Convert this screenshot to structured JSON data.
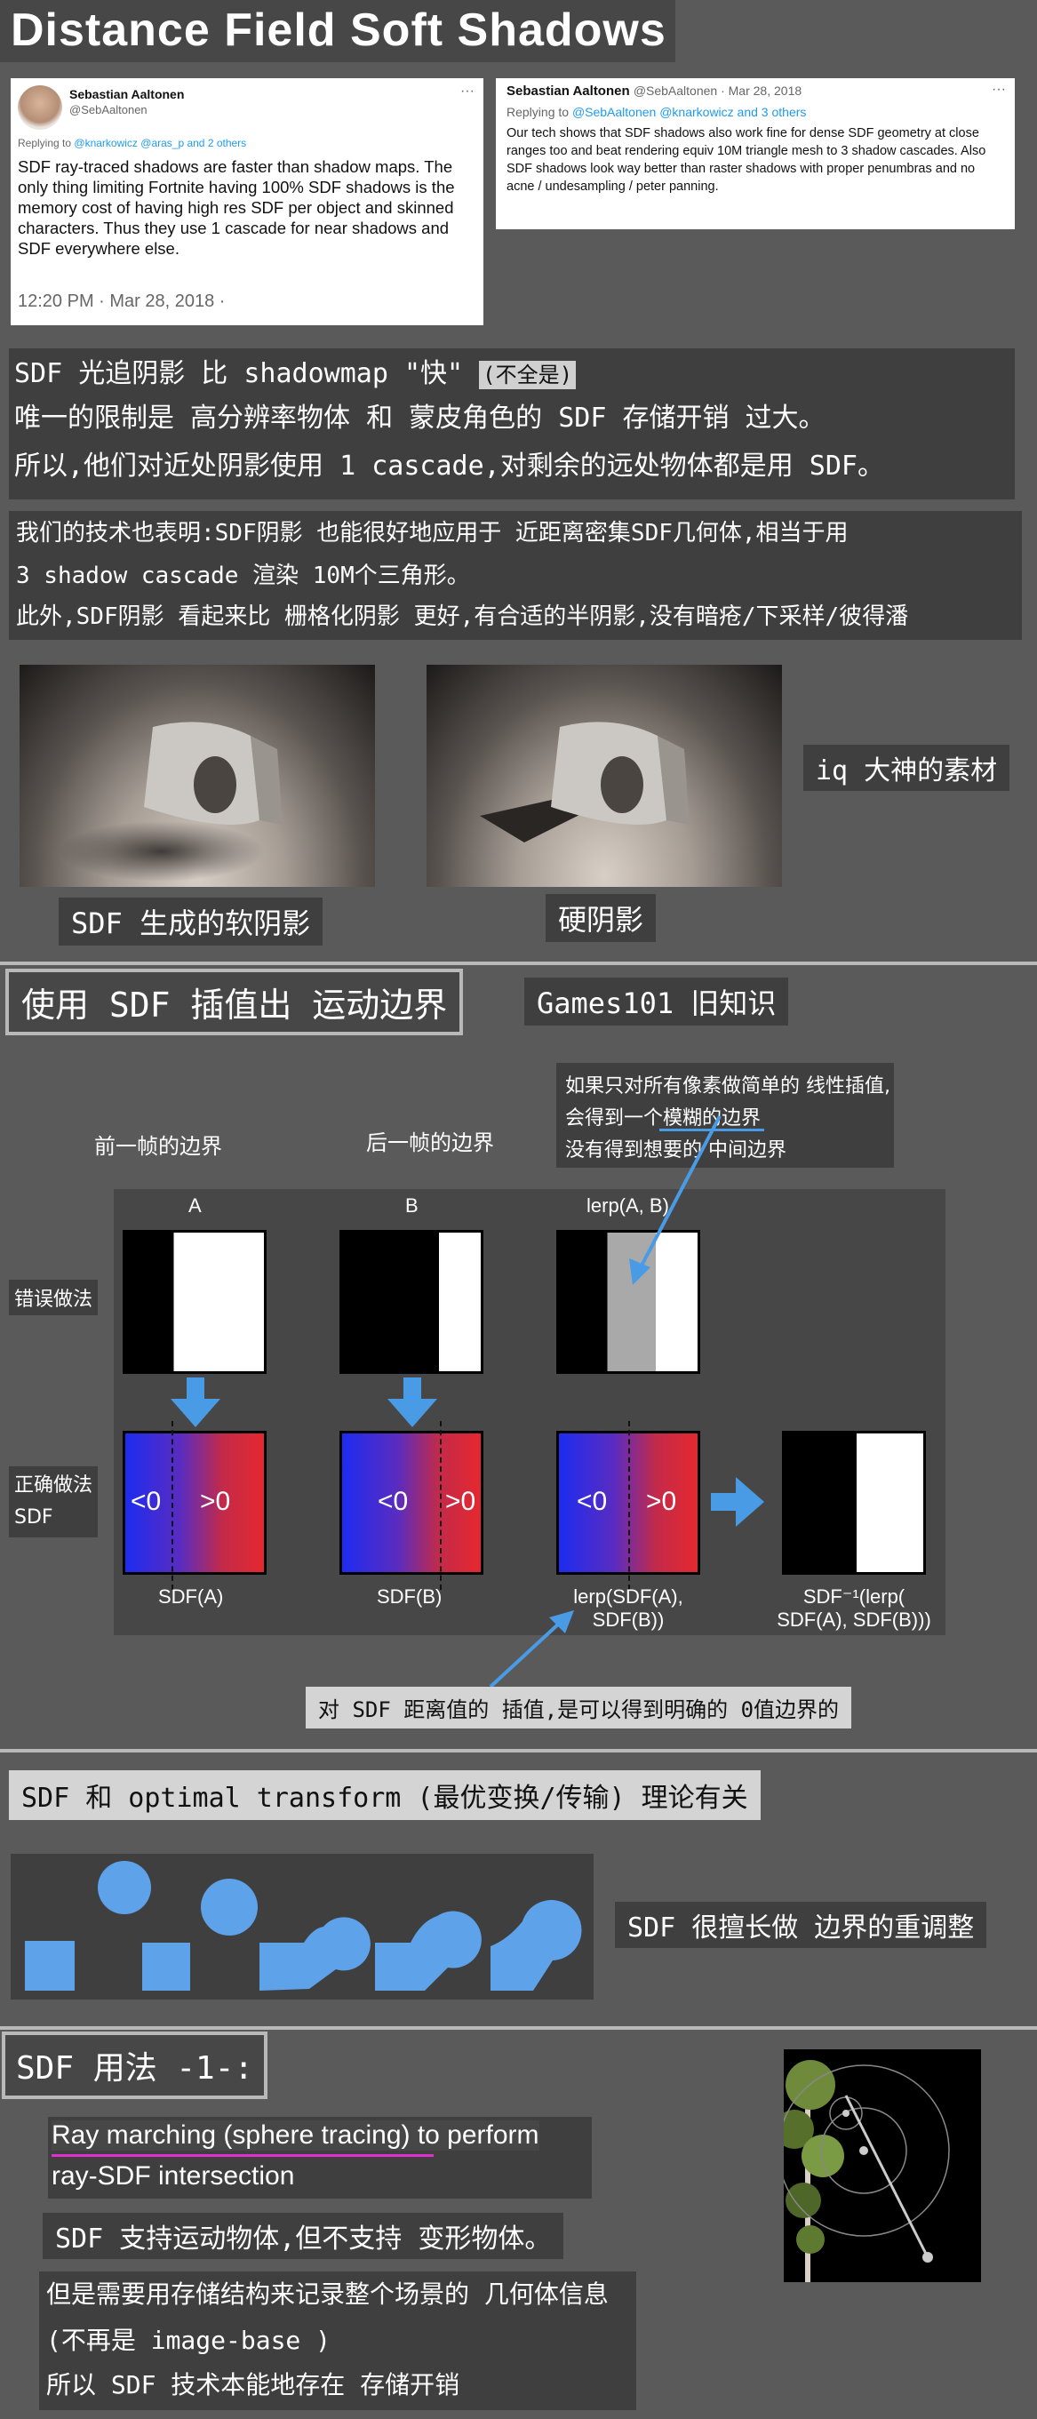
{
  "title": "Distance Field Soft Shadows",
  "tweet1": {
    "name": "Sebastian Aaltonen",
    "handle": "@SebAaltonen",
    "more": "···",
    "reply_prefix": "Replying to",
    "reply_to": "@knarkowicz @aras_p and 2 others",
    "body": "SDF ray-traced shadows are faster than shadow maps. The only thing limiting Fortnite having 100% SDF shadows is the memory cost of having high res SDF per object and skinned characters. Thus they use 1 cascade for near shadows and SDF everywhere else.",
    "time": "12:20 PM · Mar 28, 2018 ·"
  },
  "tweet2": {
    "name": "Sebastian Aaltonen",
    "handle": "@SebAaltonen · Mar 28, 2018",
    "more": "···",
    "reply_prefix": "Replying to",
    "reply_to": "@SebAaltonen @knarkowicz and 3 others",
    "body": "Our tech shows that SDF shadows also work fine for dense SDF geometry at close ranges too and beat rendering equiv 10M triangle mesh to 3 shadow cascades. Also SDF shadows look way better than raster shadows with proper penumbras and no acne / undesampling / peter panning."
  },
  "notes1": {
    "line1": "SDF 光追阴影 比 shadowmap \"快\"",
    "line1_tag": "(不全是)",
    "line2": "唯一的限制是 高分辨率物体 和 蒙皮角色的 SDF 存储开销 过大。",
    "line3": "所以,他们对近处阴影使用 1 cascade,对剩余的远处物体都是用 SDF。"
  },
  "notes2": {
    "line1": "我们的技术也表明:SDF阴影 也能很好地应用于 近距离密集SDF几何体,相当于用",
    "line2": "3 shadow cascade 渲染 10M个三角形。",
    "line3": "此外,SDF阴影 看起来比 栅格化阴影 更好,有合适的半阴影,没有暗疮/下采样/彼得潘"
  },
  "shadow_section": {
    "soft_label": "SDF 生成的软阴影",
    "hard_label": "硬阴影",
    "source_label": "iq 大神的素材"
  },
  "interp_section": {
    "heading": "使用 SDF 插值出 运动边界",
    "tag": "Games101 旧知识",
    "prev_frame": "前一帧的边界",
    "next_frame": "后一帧的边界",
    "note1": "如果只对所有像素做简单的 线性插值,",
    "note2": "会得到一个模糊的边界",
    "note3": "没有得到想要的 中间边界",
    "col_a": "A",
    "col_b": "B",
    "col_lerp": "lerp(A, B)",
    "wrong": "错误做法",
    "right1": "正确做法",
    "right2": "SDF",
    "neg": "<0",
    "pos": ">0",
    "sdf_a": "SDF(A)",
    "sdf_b": "SDF(B)",
    "lerp_sdf1": "lerp(SDF(A),",
    "lerp_sdf2": "SDF(B))",
    "inv1": "SDF⁻¹(lerp(",
    "inv2": "SDF(A), SDF(B)))",
    "bottom_note": "对 SDF 距离值的 插值,是可以得到明确的 0值边界的"
  },
  "ot_section": {
    "heading": "SDF 和 optimal transform (最优变换/传输) 理论有关",
    "side_note": "SDF 很擅长做 边界的重调整",
    "shape_color": "#5ea2ea"
  },
  "usage_section": {
    "heading": "SDF 用法 -1-:",
    "rm1": "Ray marching (sphere tracing) to perform",
    "rm2": "ray-SDF intersection",
    "moving": "SDF 支持运动物体,但不支持 变形物体。",
    "store1": "但是需要用存储结构来记录整个场景的 几何体信息",
    "store2": "(不再是 image-base )",
    "store3": "所以 SDF 技术本能地存在 存储开销"
  },
  "colors": {
    "background": "#5a5a5a",
    "panel": "#3f3f3f",
    "link": "#1d9bf0",
    "accent_blue": "#4a9be5",
    "underline_magenta": "#e030d0"
  }
}
